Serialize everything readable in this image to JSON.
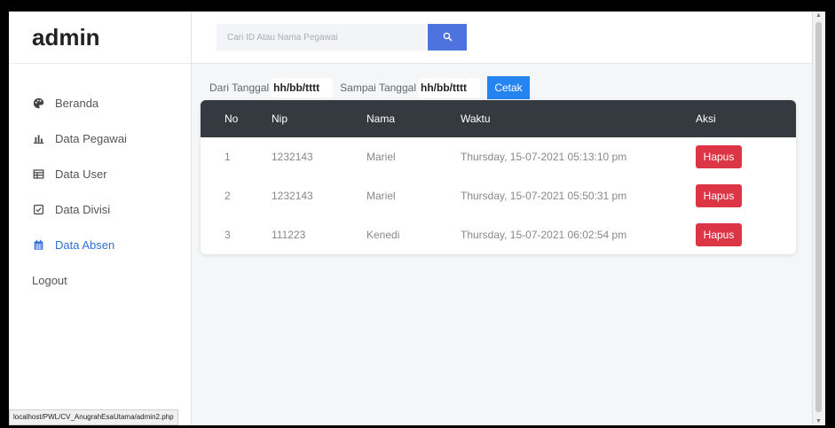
{
  "sidebar": {
    "brand": "admin",
    "items": [
      {
        "label": "Beranda"
      },
      {
        "label": "Data Pegawai"
      },
      {
        "label": "Data User"
      },
      {
        "label": "Data Divisi"
      },
      {
        "label": "Data Absen"
      },
      {
        "label": "Logout"
      }
    ],
    "active_color": "#2f6fd6"
  },
  "header": {
    "search_placeholder": "Cari ID Atau Nama Pegawai",
    "search_button_color": "#4e73df"
  },
  "filter": {
    "from_label": "Dari Tanggal",
    "from_value": "hh/bb/tttt",
    "to_label": "Sampai Tanggal",
    "to_value": "hh/bb/tttt",
    "print_label": "Cetak"
  },
  "table": {
    "columns": [
      "No",
      "Nip",
      "Nama",
      "Waktu",
      "Aksi"
    ],
    "rows": [
      {
        "no": "1",
        "nip": "1232143",
        "nama": "Mariel",
        "waktu": "Thursday, 15-07-2021 05:13:10 pm",
        "action": "Hapus"
      },
      {
        "no": "2",
        "nip": "1232143",
        "nama": "Mariel",
        "waktu": "Thursday, 15-07-2021 05:50:31 pm",
        "action": "Hapus"
      },
      {
        "no": "3",
        "nip": "111223",
        "nama": "Kenedi",
        "waktu": "Thursday, 15-07-2021 06:02:54 pm",
        "action": "Hapus"
      }
    ]
  },
  "status_url": "localhost/PWL/CV_AnugrahEsaUtama/admin2.php"
}
